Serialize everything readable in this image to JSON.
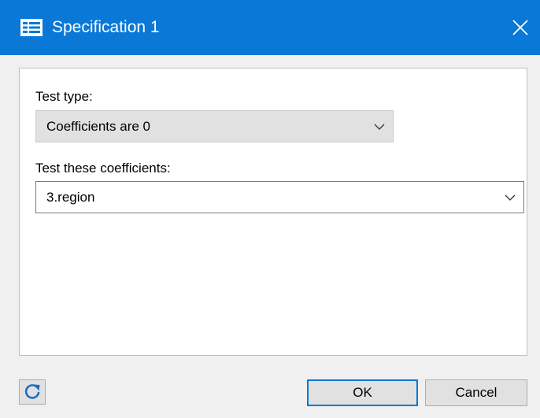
{
  "window": {
    "title": "Specification 1",
    "title_icon": "form-list-icon",
    "close_icon": "close-icon"
  },
  "form": {
    "test_type": {
      "label": "Test type:",
      "value": "Coefficients are 0"
    },
    "coefficients": {
      "label": "Test these coefficients:",
      "value": "3.region"
    }
  },
  "footer": {
    "reset_icon": "refresh-icon",
    "ok_label": "OK",
    "cancel_label": "Cancel"
  },
  "colors": {
    "titlebar": "#0a78d7",
    "focus_border": "#0078d7",
    "button_face": "#e1e1e1"
  }
}
